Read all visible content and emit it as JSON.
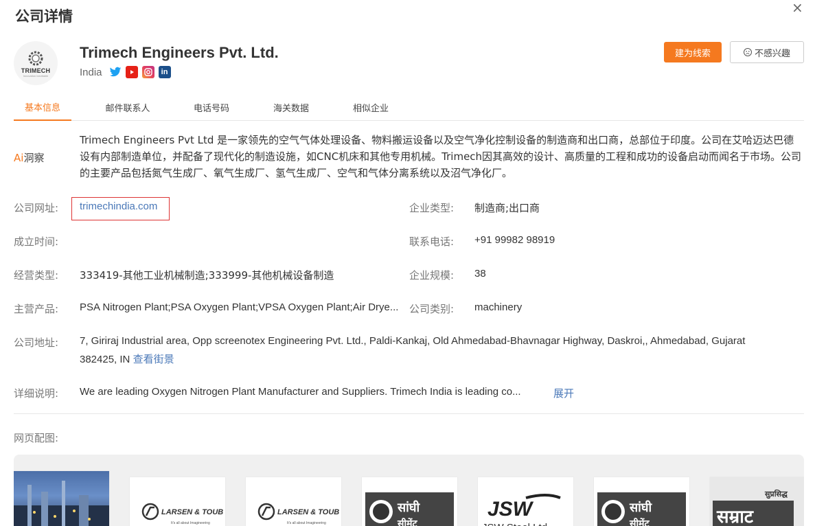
{
  "page_title": "公司详情",
  "close_glyph": "×",
  "company": {
    "name": "Trimech Engineers Pvt. Ltd.",
    "country": "India",
    "logo_text": "TRIMECH",
    "logo_sub": "Innovation inevitable",
    "social": [
      "twitter-icon",
      "youtube-icon",
      "instagram-icon",
      "linkedin-icon"
    ]
  },
  "buttons": {
    "lead": "建为线索",
    "not_interested": "不感兴趣"
  },
  "tabs": [
    "基本信息",
    "邮件联系人",
    "电话号码",
    "海关数据",
    "相似企业"
  ],
  "ai": {
    "label_ai": "Ai",
    "label_rest": "洞察",
    "text": "Trimech Engineers Pvt Ltd 是一家领先的空气气体处理设备、物料搬运设备以及空气净化控制设备的制造商和出口商，总部位于印度。公司在艾哈迈达巴德设有内部制造单位，并配备了现代化的制造设施，如CNC机床和其他专用机械。Trimech因其高效的设计、高质量的工程和成功的设备启动而闻名于市场。公司的主要产品包括氮气生成厂、氧气生成厂、氢气生成厂、空气和气体分离系统以及沼气净化厂。"
  },
  "info": {
    "website_label": "公司网址:",
    "website": "trimechindia.com",
    "type_label": "企业类型:",
    "type": "制造商;出口商",
    "founded_label": "成立时间:",
    "founded": "",
    "phone_label": "联系电话:",
    "phone": "+91 99982 98919",
    "business_label": "经营类型:",
    "business": "333419-其他工业机械制造;333999-其他机械设备制造",
    "scale_label": "企业规模:",
    "scale": "38",
    "products_label": "主营产品:",
    "products": "PSA Nitrogen Plant;PSA Oxygen Plant;VPSA Oxygen Plant;Air Drye...",
    "category_label": "公司类别:",
    "category": "machinery",
    "address_label": "公司地址:",
    "address_line1": "7, Giriraj Industrial area, Opp screenotex Engineering Pvt. Ltd., Paldi-Kankaj, Old Ahmedabad-Bhavnagar Highway, Daskroi,, Ahmedabad, Gujarat",
    "address_line2": "382425, IN",
    "street_view": "查看街景",
    "desc_label": "详细说明:",
    "desc": "We are leading Oxygen Nitrogen Plant Manufacturer and Suppliers. Trimech India is leading co...",
    "expand": "展开"
  },
  "gallery": {
    "label": "网页配图:",
    "thumbs": [
      {
        "kind": "photo",
        "text": ""
      },
      {
        "kind": "lt",
        "text": "LARSEN & TOUB",
        "sub": "It's all about Imagineering"
      },
      {
        "kind": "lt",
        "text": "LARSEN & TOUB",
        "sub": "It's all about Imagineering"
      },
      {
        "kind": "sanghi",
        "text": "सांघी सीमेंट"
      },
      {
        "kind": "jsw",
        "text": "JSW",
        "sub": "JSW Steel Ltd"
      },
      {
        "kind": "sanghi",
        "text": "सांघी सीमेंट"
      },
      {
        "kind": "samrat",
        "text": "सम्राट",
        "sub": "सुप्रसिद्ध"
      }
    ]
  },
  "colors": {
    "accent": "#f5791f",
    "link": "#4a78b8",
    "highlight_border": "#dd3333"
  }
}
